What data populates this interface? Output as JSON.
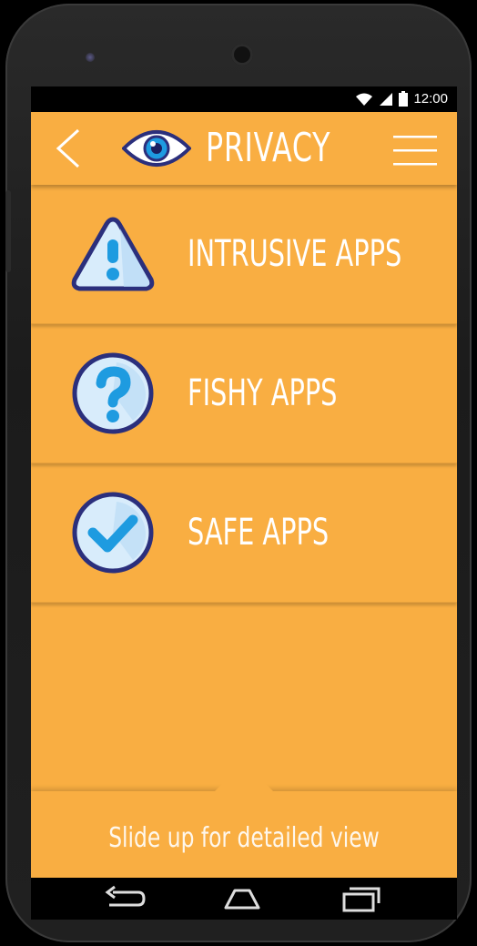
{
  "status_bar": {
    "time": "12:00"
  },
  "app_bar": {
    "title": "PRIVACY"
  },
  "categories": [
    {
      "label": "INTRUSIVE APPS",
      "icon": "warning-icon"
    },
    {
      "label": "FISHY APPS",
      "icon": "question-icon"
    },
    {
      "label": "SAFE APPS",
      "icon": "check-icon"
    }
  ],
  "slide_panel": {
    "text": "Slide up for detailed view"
  },
  "colors": {
    "accent": "#f9ae42",
    "icon_outline": "#2b2f7c",
    "icon_fill": "#d8ecfb",
    "icon_blue": "#1e9be0"
  }
}
